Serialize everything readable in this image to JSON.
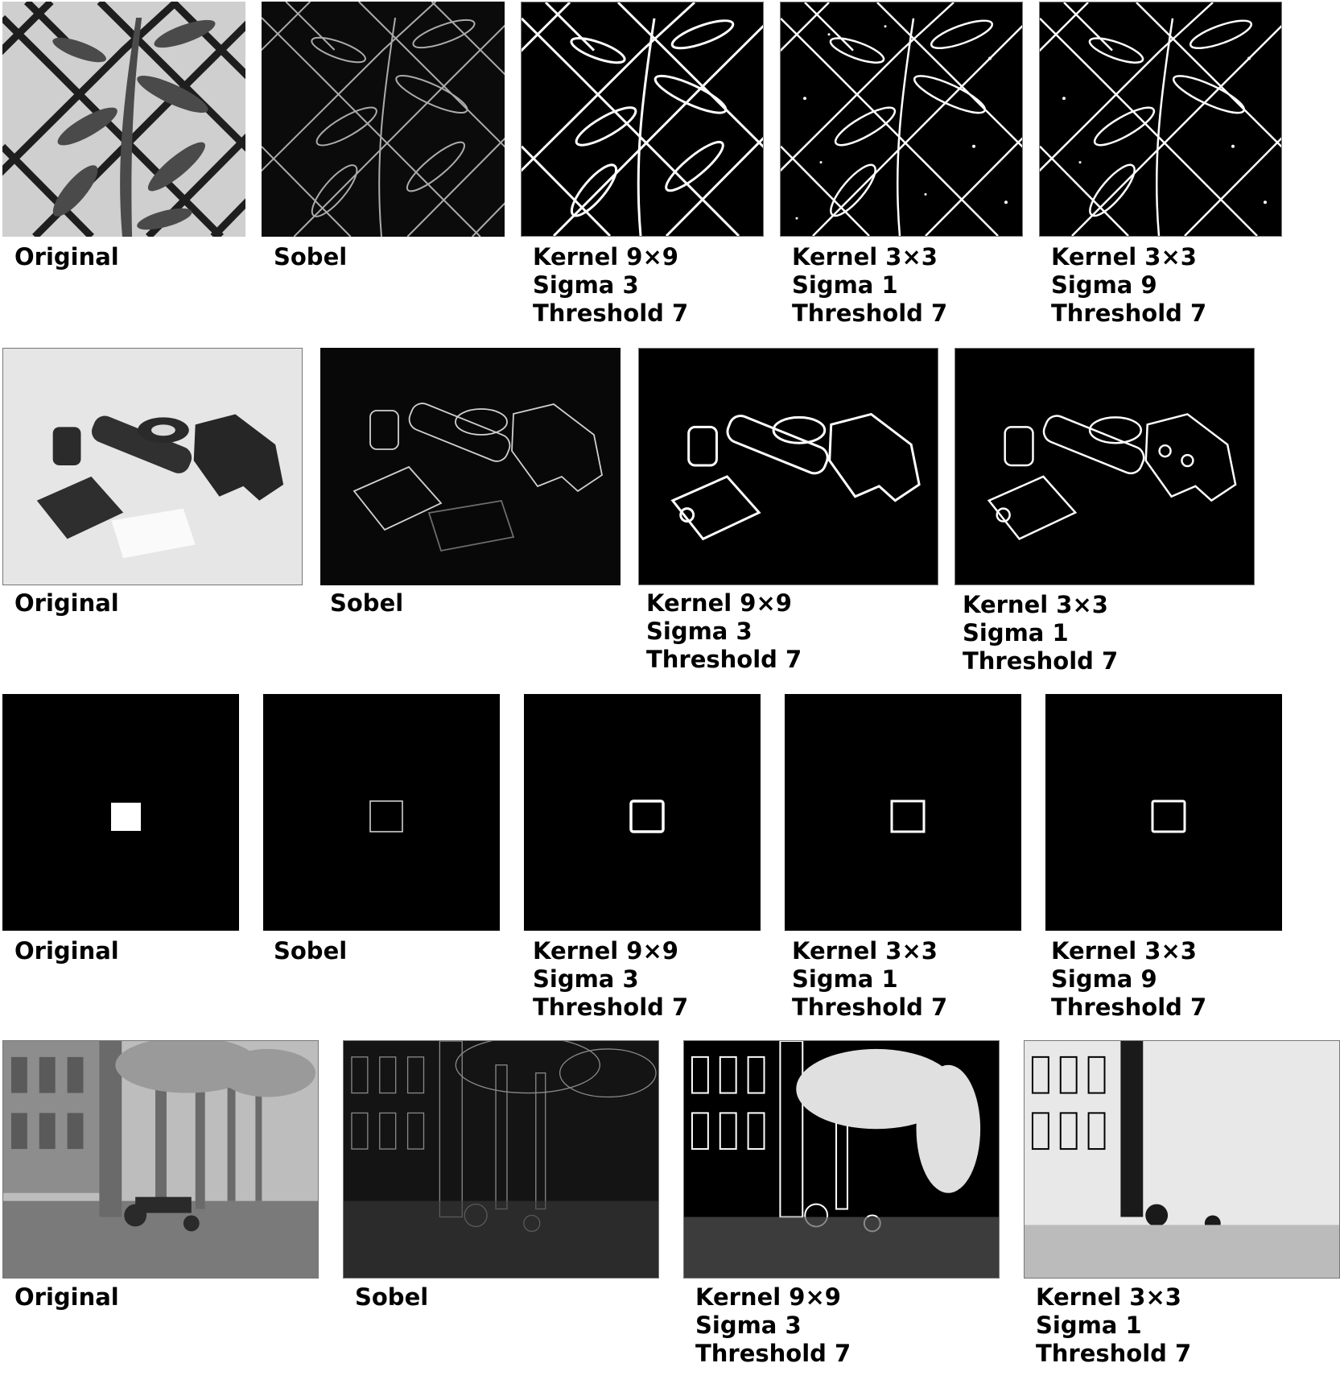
{
  "rows": [
    {
      "subject": "leaf-on-chain-link-fence",
      "captions": [
        [
          "Original"
        ],
        [
          "Sobel"
        ],
        [
          "Kernel 9×9",
          "Sigma 3",
          "Threshold 7"
        ],
        [
          "Kernel 3×3",
          "Sigma 1",
          "Threshold 7"
        ],
        [
          "Kernel 3×3",
          "Sigma 9",
          "Threshold 7"
        ]
      ]
    },
    {
      "subject": "machined-parts-on-table",
      "captions": [
        [
          "Original"
        ],
        [
          "Sobel"
        ],
        [
          "Kernel 9×9",
          "Sigma 3",
          "Threshold 7"
        ],
        [
          "Kernel 3×3",
          "Sigma 1",
          "Threshold 7"
        ]
      ]
    },
    {
      "subject": "white-square-on-black",
      "captions": [
        [
          "Original"
        ],
        [
          "Sobel"
        ],
        [
          "Kernel 9×9",
          "Sigma 3",
          "Threshold 7"
        ],
        [
          "Kernel 3×3",
          "Sigma 1",
          "Threshold 7"
        ],
        [
          "Kernel 3×3",
          "Sigma 9",
          "Threshold 7"
        ]
      ]
    },
    {
      "subject": "palm-trees-and-tractor",
      "captions": [
        [
          "Original"
        ],
        [
          "Sobel"
        ],
        [
          "Kernel 9×9",
          "Sigma 3",
          "Threshold 7"
        ],
        [
          "Kernel 3×3",
          "Sigma 1",
          "Threshold 7"
        ]
      ]
    }
  ]
}
